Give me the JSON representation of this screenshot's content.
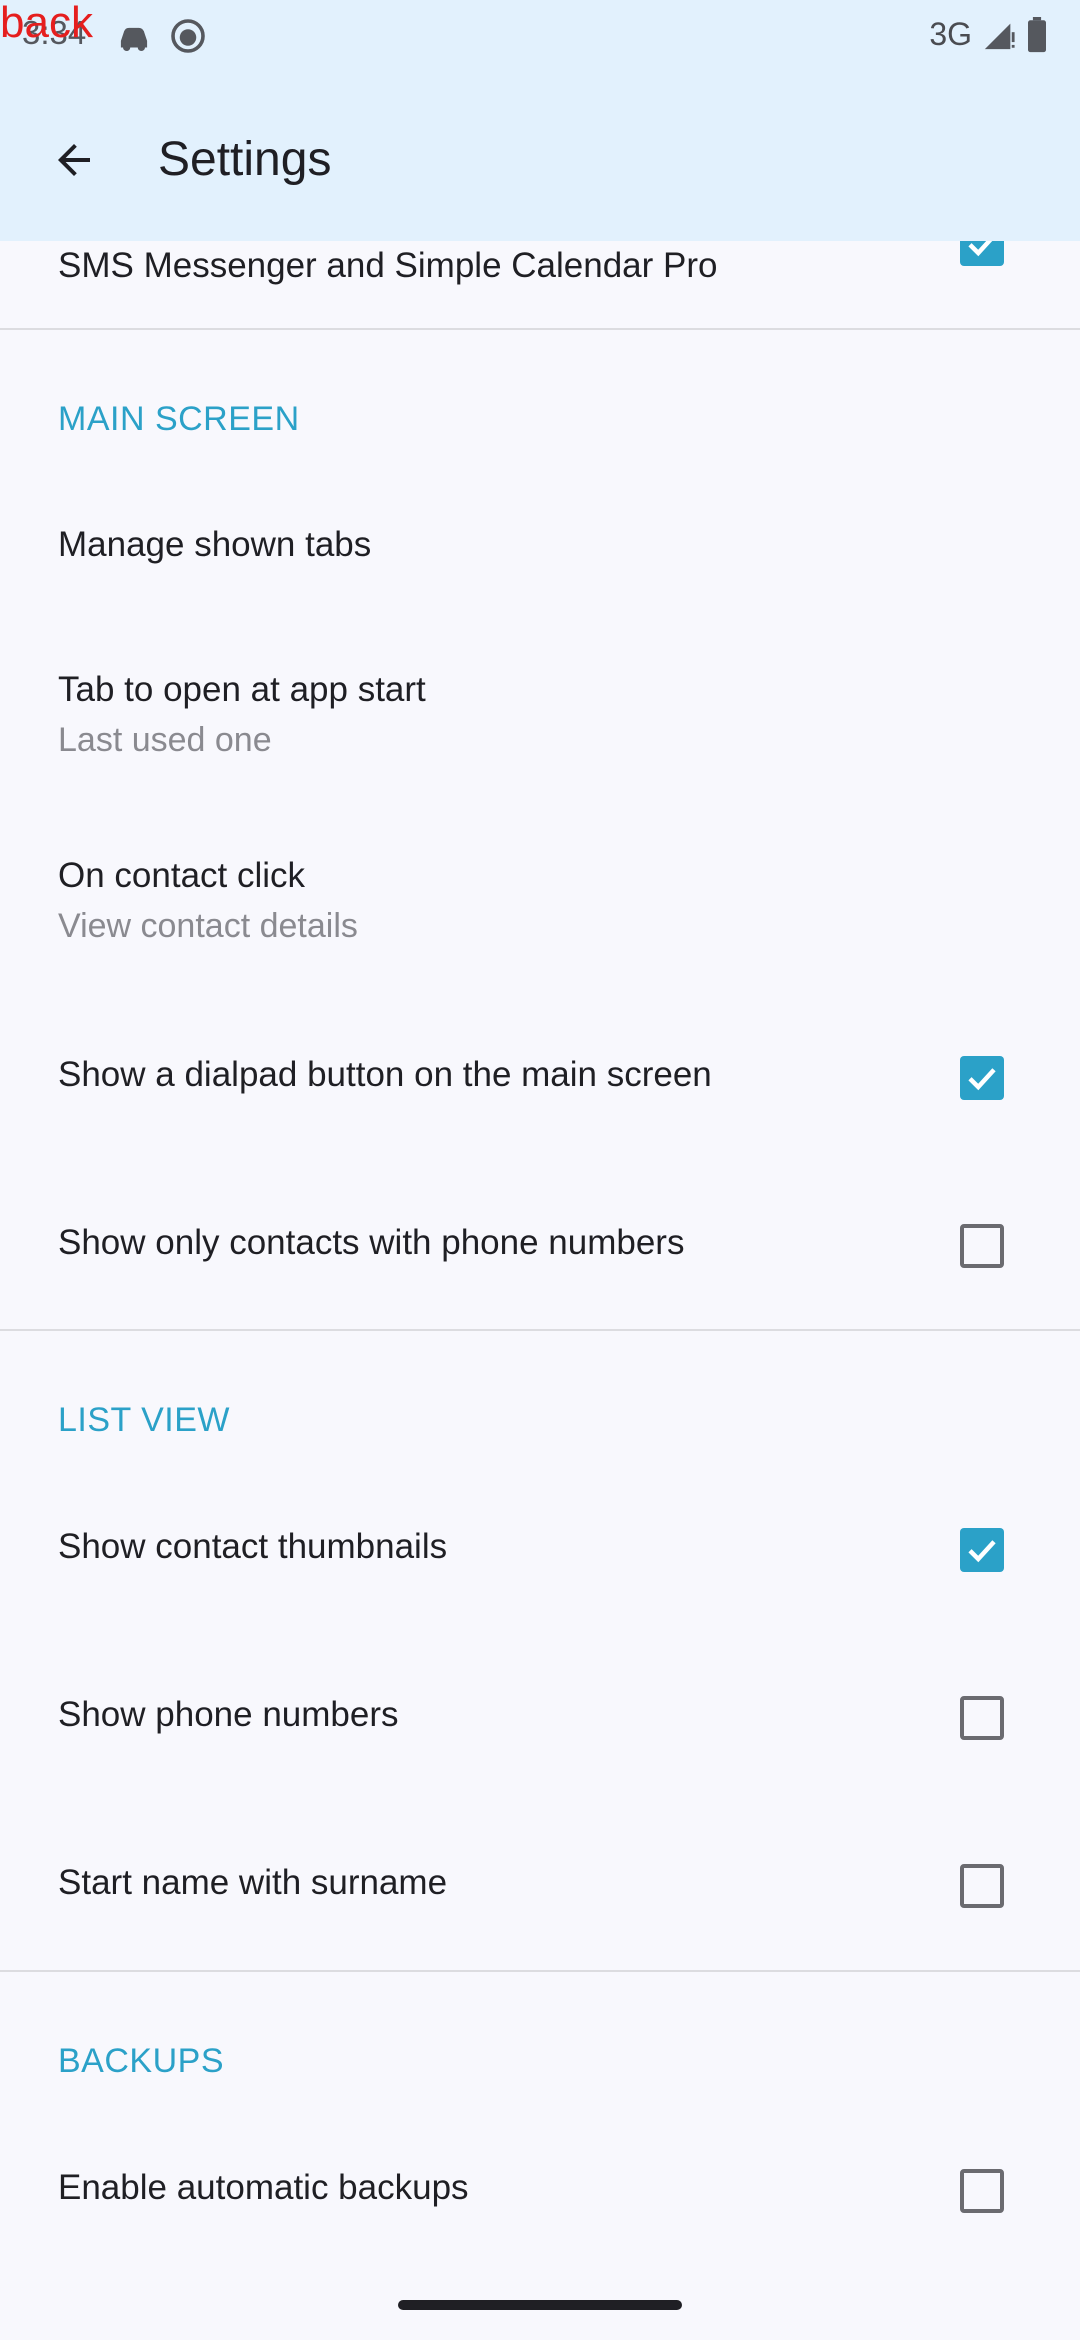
{
  "status": {
    "time": "3:34",
    "network": "3G",
    "overlay_text": "back"
  },
  "toolbar": {
    "title": "Settings",
    "back_icon": "arrow-back-icon"
  },
  "top_item": {
    "label": "SMS Messenger and Simple Calendar Pro",
    "checked": true
  },
  "main_screen": {
    "header": "MAIN SCREEN",
    "manage_tabs": "Manage shown tabs",
    "tab_open": {
      "title": "Tab to open at app start",
      "value": "Last used one"
    },
    "contact_click": {
      "title": "On contact click",
      "value": "View contact details"
    },
    "dialpad": {
      "label": "Show a dialpad button on the main screen",
      "checked": true
    },
    "only_phone": {
      "label": "Show only contacts with phone numbers",
      "checked": false
    }
  },
  "list_view": {
    "header": "LIST VIEW",
    "thumbnails": {
      "label": "Show contact thumbnails",
      "checked": true
    },
    "phone_numbers": {
      "label": "Show phone numbers",
      "checked": false
    },
    "surname": {
      "label": "Start name with surname",
      "checked": false
    }
  },
  "backups": {
    "header": "BACKUPS",
    "auto_backups": {
      "label": "Enable automatic backups",
      "checked": false
    }
  },
  "colors": {
    "accent": "#2ba1c8",
    "appbar": "#e2f1fd",
    "background": "#f8f8fd"
  }
}
